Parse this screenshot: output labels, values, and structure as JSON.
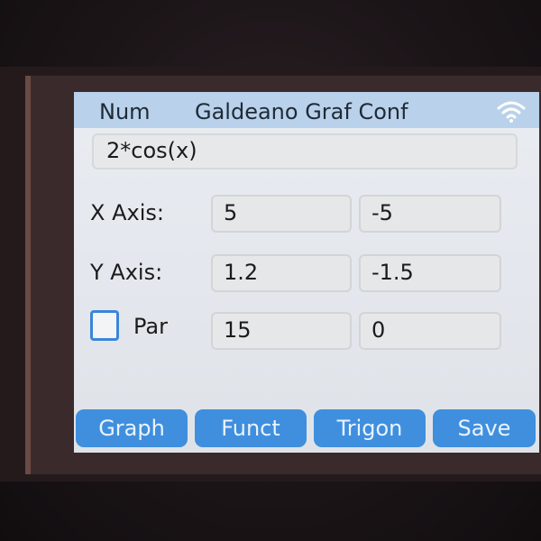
{
  "header": {
    "left_label": "Num",
    "title": "Galdeano Graf Conf",
    "status_icon": "wifi-icon"
  },
  "function": {
    "value": "2*cos(x)"
  },
  "x_axis": {
    "label": "X Axis:",
    "max": "5",
    "min": "-5"
  },
  "y_axis": {
    "label": "Y Axis:",
    "max": "1.2",
    "min": "-1.5"
  },
  "par": {
    "checked": false,
    "label": "Par",
    "value1": "15",
    "value2": "0"
  },
  "buttons": {
    "graph": "Graph",
    "funct": "Funct",
    "trigon": "Trigon",
    "save": "Save"
  },
  "colors": {
    "titlebar": "#b9d1ea",
    "button": "#3f8fde",
    "checkbox_border": "#3a86d8",
    "screen_bg": "#e6e9ee"
  }
}
